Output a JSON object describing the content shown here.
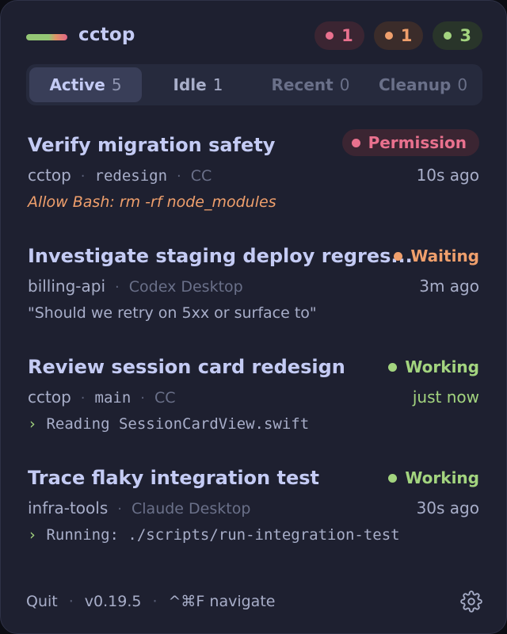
{
  "header": {
    "app_title": "cctop",
    "badges": [
      {
        "color": "#e9718e",
        "count": "1"
      },
      {
        "color": "#ef9f6c",
        "count": "1"
      },
      {
        "color": "#a3d47f",
        "count": "3"
      }
    ]
  },
  "tabs": [
    {
      "label": "Active",
      "count": "5",
      "selected": true
    },
    {
      "label": "Idle",
      "count": "1"
    },
    {
      "label": "Recent",
      "count": "0"
    },
    {
      "label": "Cleanup",
      "count": "0"
    }
  ],
  "sessions": [
    {
      "title": "Verify migration safety",
      "status": "Permission",
      "project": "cctop",
      "branch": "redesign",
      "source": "CC",
      "time": "10s ago",
      "detail": "Allow Bash: rm -rf node_modules"
    },
    {
      "title": "Investigate staging deploy regres...",
      "status": "Waiting",
      "project": "billing-api",
      "source": "Codex Desktop",
      "time": "3m ago",
      "detail": "\"Should we retry on 5xx or surface to\""
    },
    {
      "title": "Review session card redesign",
      "status": "Working",
      "project": "cctop",
      "branch": "main",
      "source": "CC",
      "time": "just now",
      "detail": "Reading SessionCardView.swift"
    },
    {
      "title": "Trace flaky integration test",
      "status": "Working",
      "project": "infra-tools",
      "source": "Claude Desktop",
      "time": "30s ago",
      "detail": "Running: ./scripts/run-integration-test"
    }
  ],
  "footer": {
    "quit_label": "Quit",
    "version": "v0.19.5",
    "shortcut": "^⌘F navigate",
    "settings_icon": "gear-icon"
  },
  "separator": "·",
  "chevron": "›"
}
